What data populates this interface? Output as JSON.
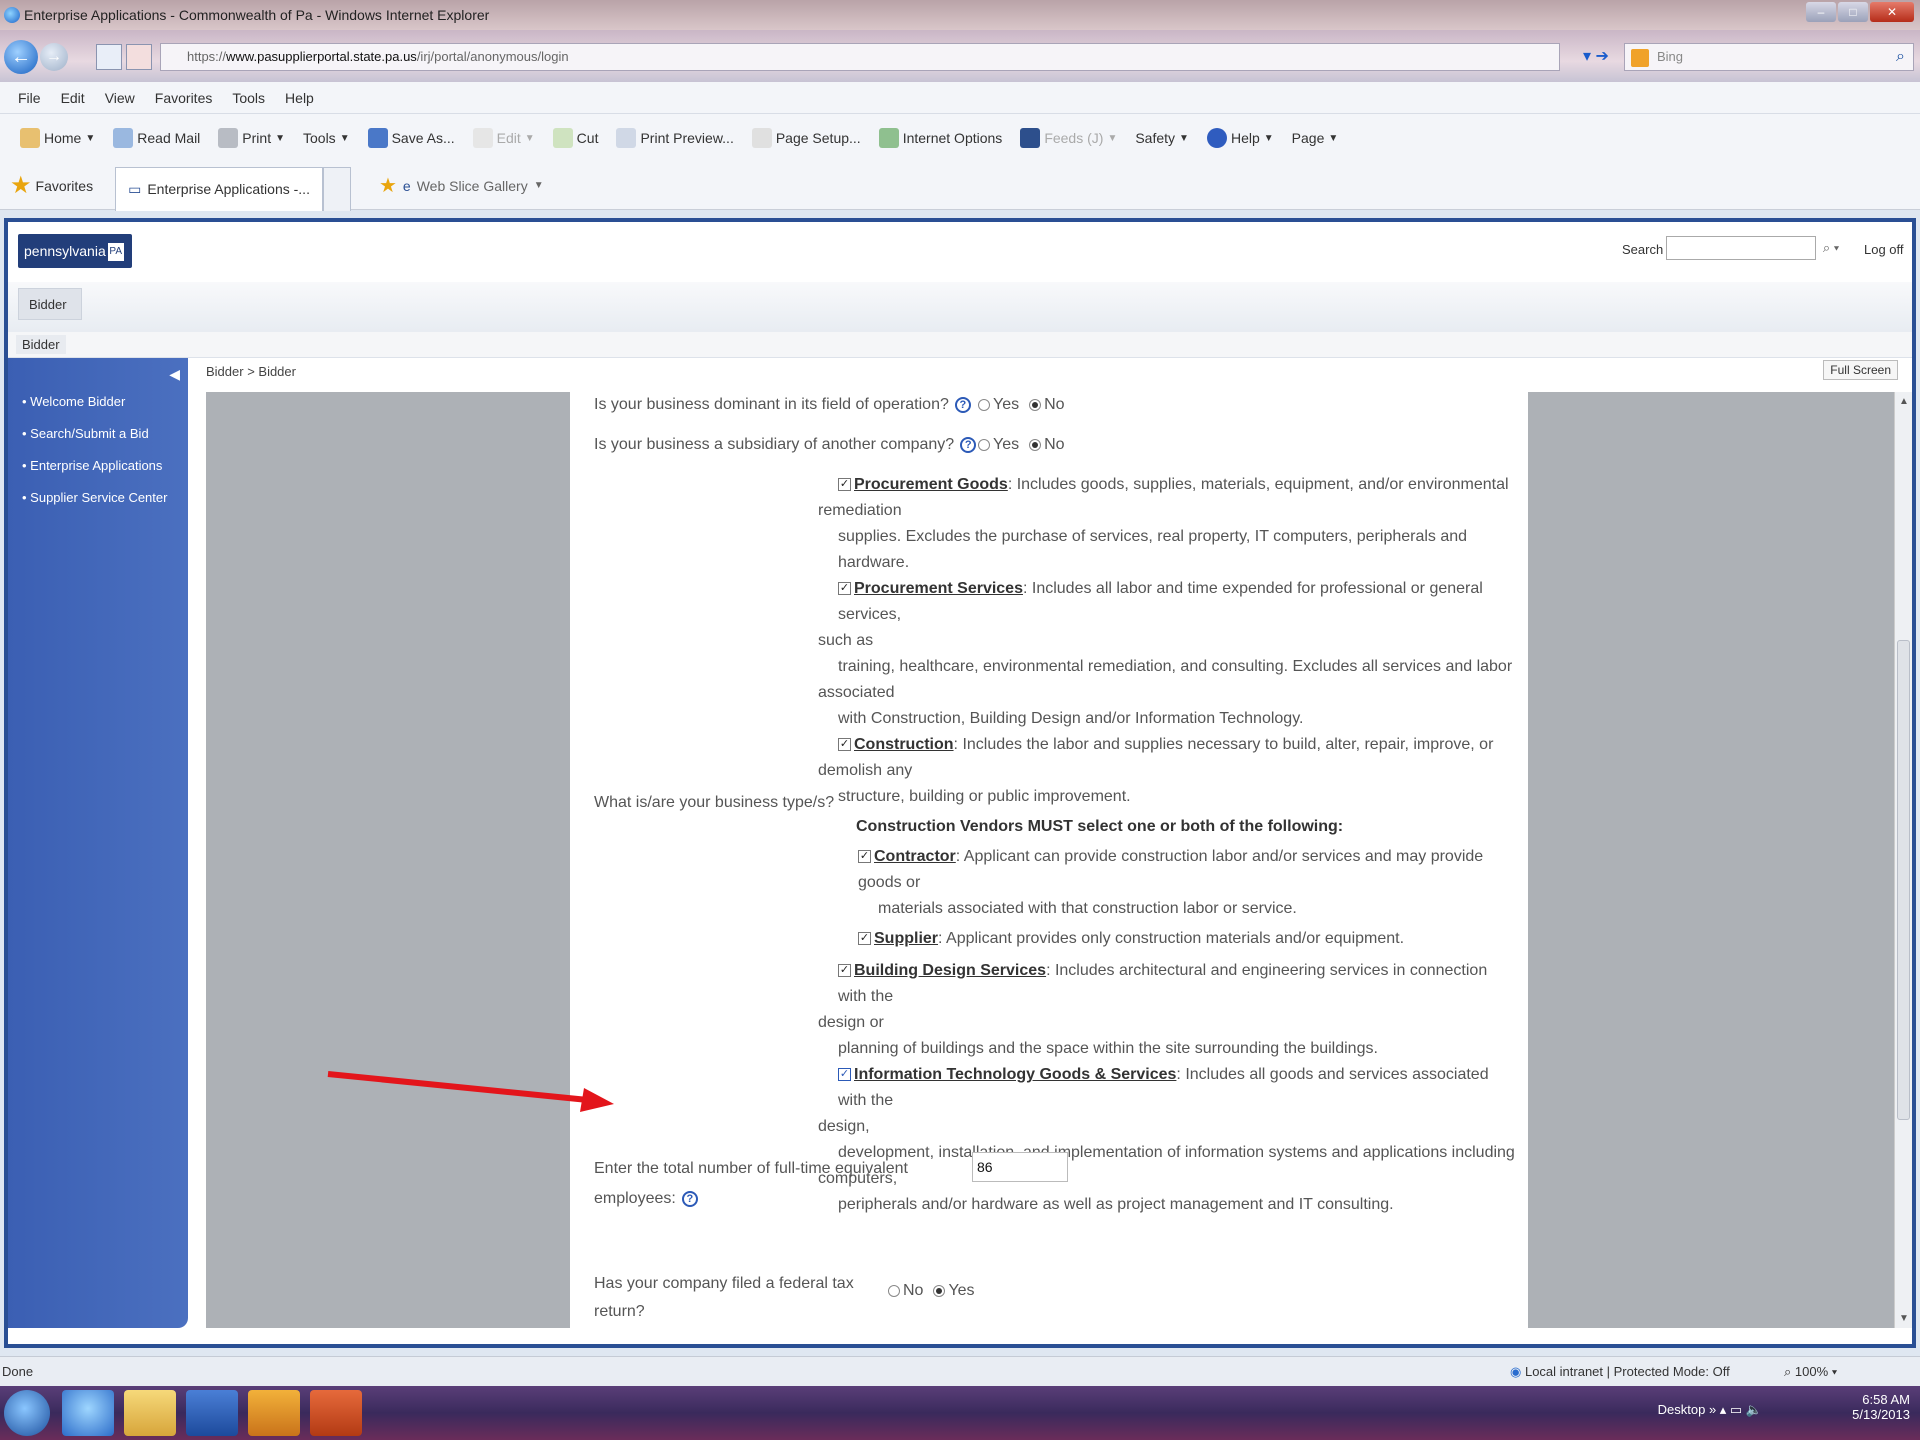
{
  "browser": {
    "window_title": "Enterprise Applications - Commonwealth of Pa - Windows Internet Explorer",
    "url_prefix": "https://",
    "url_host": "www.pasupplierportal.state.pa.us",
    "url_path": "/irj/portal/anonymous/login",
    "search_engine": "Bing",
    "menu": [
      "File",
      "Edit",
      "View",
      "Favorites",
      "Tools",
      "Help"
    ],
    "commands": [
      "Home",
      "Read Mail",
      "Print",
      "Tools",
      "Save As...",
      "Edit",
      "Cut",
      "Print Preview...",
      "Page Setup...",
      "Internet Options",
      "Feeds (J)",
      "Safety",
      "Help",
      "Page"
    ],
    "favorites_label": "Favorites",
    "tab_title": "Enterprise Applications -...",
    "web_slice": "Web Slice Gallery"
  },
  "portal": {
    "logo_text": "pennsylvania",
    "logo_badge": "PA",
    "search_label": "Search",
    "logoff": "Log off",
    "top_tab": "Bidder",
    "sub_tab": "Bidder",
    "breadcrumb": "Bidder  >  Bidder",
    "fullscreen": "Full Screen",
    "left_nav": [
      "Welcome Bidder",
      "Search/Submit a Bid",
      "Enterprise Applications",
      "Supplier Service Center"
    ]
  },
  "form": {
    "q_dominant": "Is your business dominant in its field of operation?",
    "q_dominant_yes": "Yes",
    "q_dominant_no": "No",
    "q_subsidiary": "Is your business a subsidiary of another company?",
    "q_subsidiary_yes": "Yes",
    "q_subsidiary_no": "No",
    "q_business_type": "What is/are your business type/s?",
    "types": {
      "goods_title": "Procurement Goods",
      "goods_l1": ": Includes goods, supplies, materials, equipment, and/or environmental",
      "goods_l2": "remediation",
      "goods_l3": "supplies. Excludes the purchase of services, real property, IT computers, peripherals and hardware.",
      "services_title": "Procurement Services",
      "services_l1": ": Includes all labor and time expended for professional or general services,",
      "services_l2": "such as",
      "services_l3": "training, healthcare, environmental remediation, and consulting. Excludes all services and labor",
      "services_l4": "associated",
      "services_l5": "with Construction, Building Design and/or Information Technology.",
      "construction_title": "Construction",
      "construction_l1": ": Includes the labor and supplies necessary to build, alter, repair, improve, or",
      "construction_l2": "demolish any",
      "construction_l3": "structure, building or public improvement.",
      "vendor_heading": "Construction Vendors MUST select one or both of the following:",
      "contractor_title": "Contractor",
      "contractor_l1": ": Applicant can provide construction labor and/or services and may provide",
      "contractor_l2": "goods or",
      "contractor_l3": "materials associated with that construction labor or service.",
      "supplier_title": "Supplier",
      "supplier_l1": ": Applicant provides only construction materials and/or equipment.",
      "building_title": "Building Design Services",
      "building_l1": ": Includes architectural and engineering services in connection with the",
      "building_l2": "design or",
      "building_l3": "planning of buildings and the space within the site surrounding the buildings.",
      "it_title": "Information Technology Goods & Services",
      "it_l1": ": Includes all goods and services associated with the",
      "it_l2": "design,",
      "it_l3": "development, installation, and implementation of information systems and applications including",
      "it_l4": "computers,",
      "it_l5": "peripherals and/or hardware as well as project management and IT consulting."
    },
    "employees_label_1": "Enter the total number of full-time equivalent",
    "employees_label_2": "employees:",
    "employees_value": "86",
    "tax_label_1": "Has your company filed a federal tax",
    "tax_label_2": "return?",
    "tax_no": "No",
    "tax_yes": "Yes"
  },
  "statusbar": {
    "left": "Done",
    "zone": "Local intranet | Protected Mode: Off",
    "zoom": "100%"
  },
  "taskbar": {
    "desktop": "Desktop",
    "time": "6:58 AM",
    "date": "5/13/2013"
  },
  "colors": {
    "nav_blue": "#3b5fb3",
    "annotation_arrow": "#e3151b"
  }
}
